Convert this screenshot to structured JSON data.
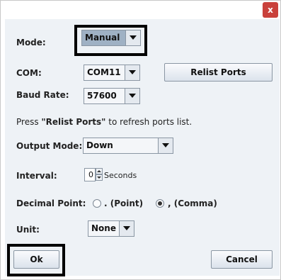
{
  "window": {
    "close_glyph": "x"
  },
  "mode": {
    "label": "Mode:",
    "value": "Manual"
  },
  "com": {
    "label": "COM:",
    "value": "COM11",
    "relist_button": "Relist Ports"
  },
  "baud": {
    "label": "Baud Rate:",
    "value": "57600"
  },
  "hint": {
    "prefix": "Press ",
    "bold": "\"Relist Ports\"",
    "suffix": " to refresh ports list."
  },
  "output_mode": {
    "label": "Output Mode:",
    "value": "Down"
  },
  "interval": {
    "label": "Interval:",
    "value": "0",
    "unit": "Seconds"
  },
  "decimal_point": {
    "label": "Decimal Point:",
    "options": [
      {
        "label": ". (Point)",
        "selected": false
      },
      {
        "label": ", (Comma)",
        "selected": true
      }
    ]
  },
  "unit": {
    "label": "Unit:",
    "value": "None"
  },
  "footer": {
    "ok": "Ok",
    "cancel": "Cancel"
  },
  "colors": {
    "close_bg": "#c9413b",
    "panel_bg": "#eef2f6",
    "highlight_combo": "#9fb1c4"
  }
}
